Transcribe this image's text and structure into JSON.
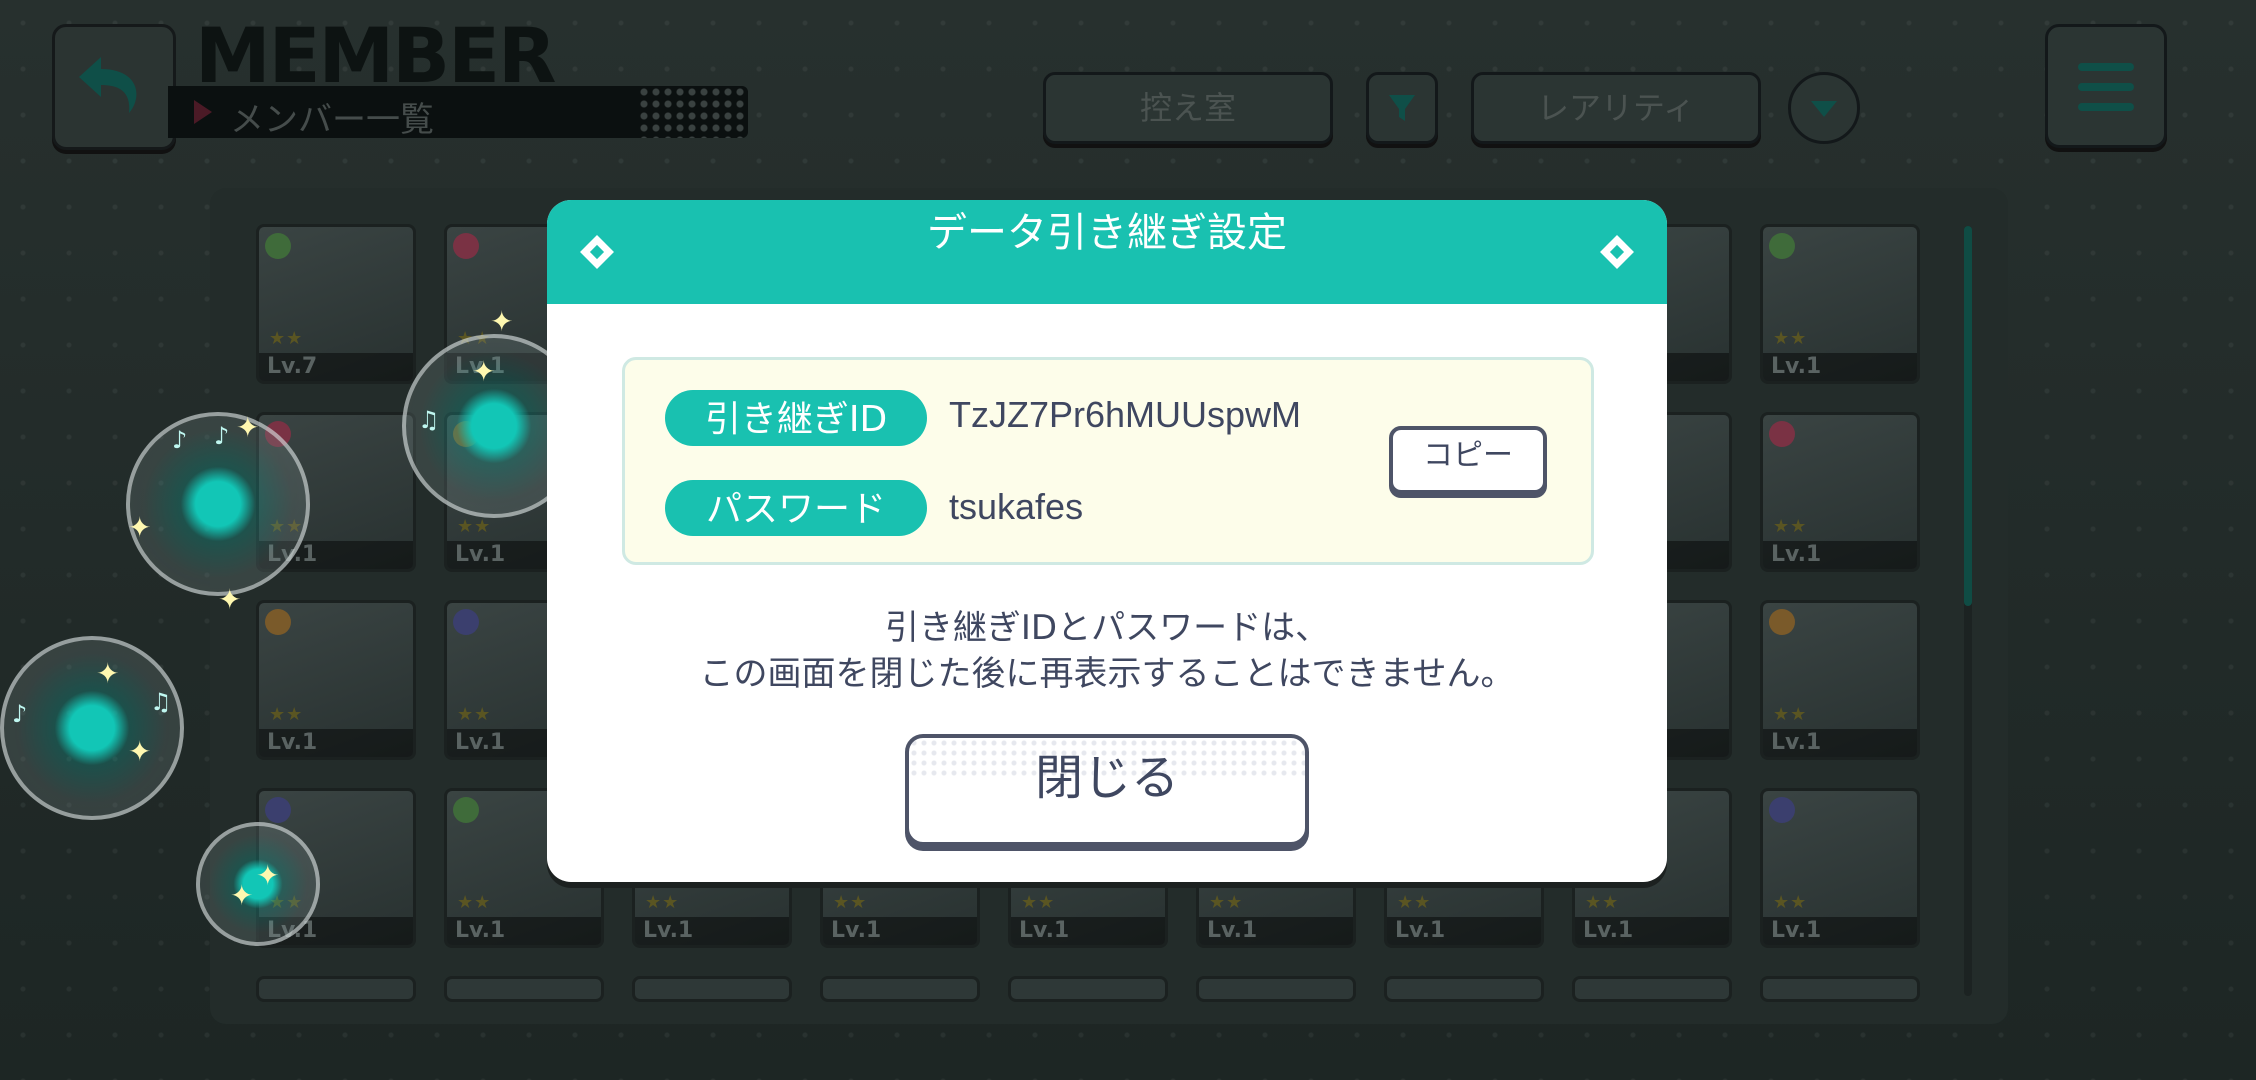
{
  "header": {
    "title": "MEMBER",
    "subtitle": "メンバー一覧",
    "room_button": "控え室",
    "sort_button": "レアリティ"
  },
  "member_grid": {
    "levels": [
      "Lv.7",
      "Lv.1",
      "Lv.1",
      "Lv.1",
      "Lv.1",
      "Lv.1",
      "Lv.1",
      "Lv.1",
      "Lv.1",
      "Lv.1",
      "Lv.1",
      "Lv.1",
      "Lv.1",
      "Lv.1",
      "Lv.1",
      "Lv.1",
      "Lv.1",
      "Lv.1",
      "Lv.1",
      "Lv.1",
      "Lv.1",
      "Lv.1",
      "Lv.1",
      "Lv.1",
      "Lv.1",
      "Lv.1",
      "Lv.1",
      "Lv.1",
      "Lv.1",
      "Lv.1",
      "Lv.1",
      "Lv.1",
      "Lv.1",
      "Lv.1",
      "Lv.1",
      "Lv.1",
      "Lv.1",
      "Lv.1",
      "Lv.1",
      "Lv.1"
    ]
  },
  "dialog": {
    "title": "データ引き継ぎ設定",
    "id_label": "引き継ぎID",
    "id_value": "TzJZ7Pr6hMUUspwM",
    "password_label": "パスワード",
    "password_value": "tsukafes",
    "copy_button": "コピー",
    "notice_line1": "引き継ぎIDとパスワードは、",
    "notice_line2": "この画面を閉じた後に再表示することはできません。",
    "close_button": "閉じる"
  },
  "colors": {
    "accent": "#19c1b0",
    "text": "#3f4760",
    "info_bg": "#fdfdea"
  }
}
